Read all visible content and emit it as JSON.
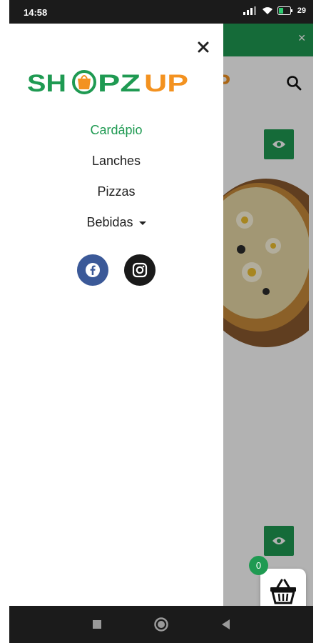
{
  "status_bar": {
    "time": "14:58",
    "battery": "29"
  },
  "colors": {
    "brand_green": "#1f9a52",
    "brand_orange": "#f39220"
  },
  "logo": {
    "part1": "SH",
    "part2": "PZ",
    "part3": "UP"
  },
  "background": {
    "logo_fragment": "P"
  },
  "drawer": {
    "menu": [
      {
        "label": "Cardápio",
        "active": true
      },
      {
        "label": "Lanches"
      },
      {
        "label": "Pizzas"
      },
      {
        "label": "Bebidas",
        "has_dropdown": true
      }
    ],
    "socials": [
      "facebook-icon",
      "instagram-icon"
    ]
  },
  "cart": {
    "count": "0"
  }
}
